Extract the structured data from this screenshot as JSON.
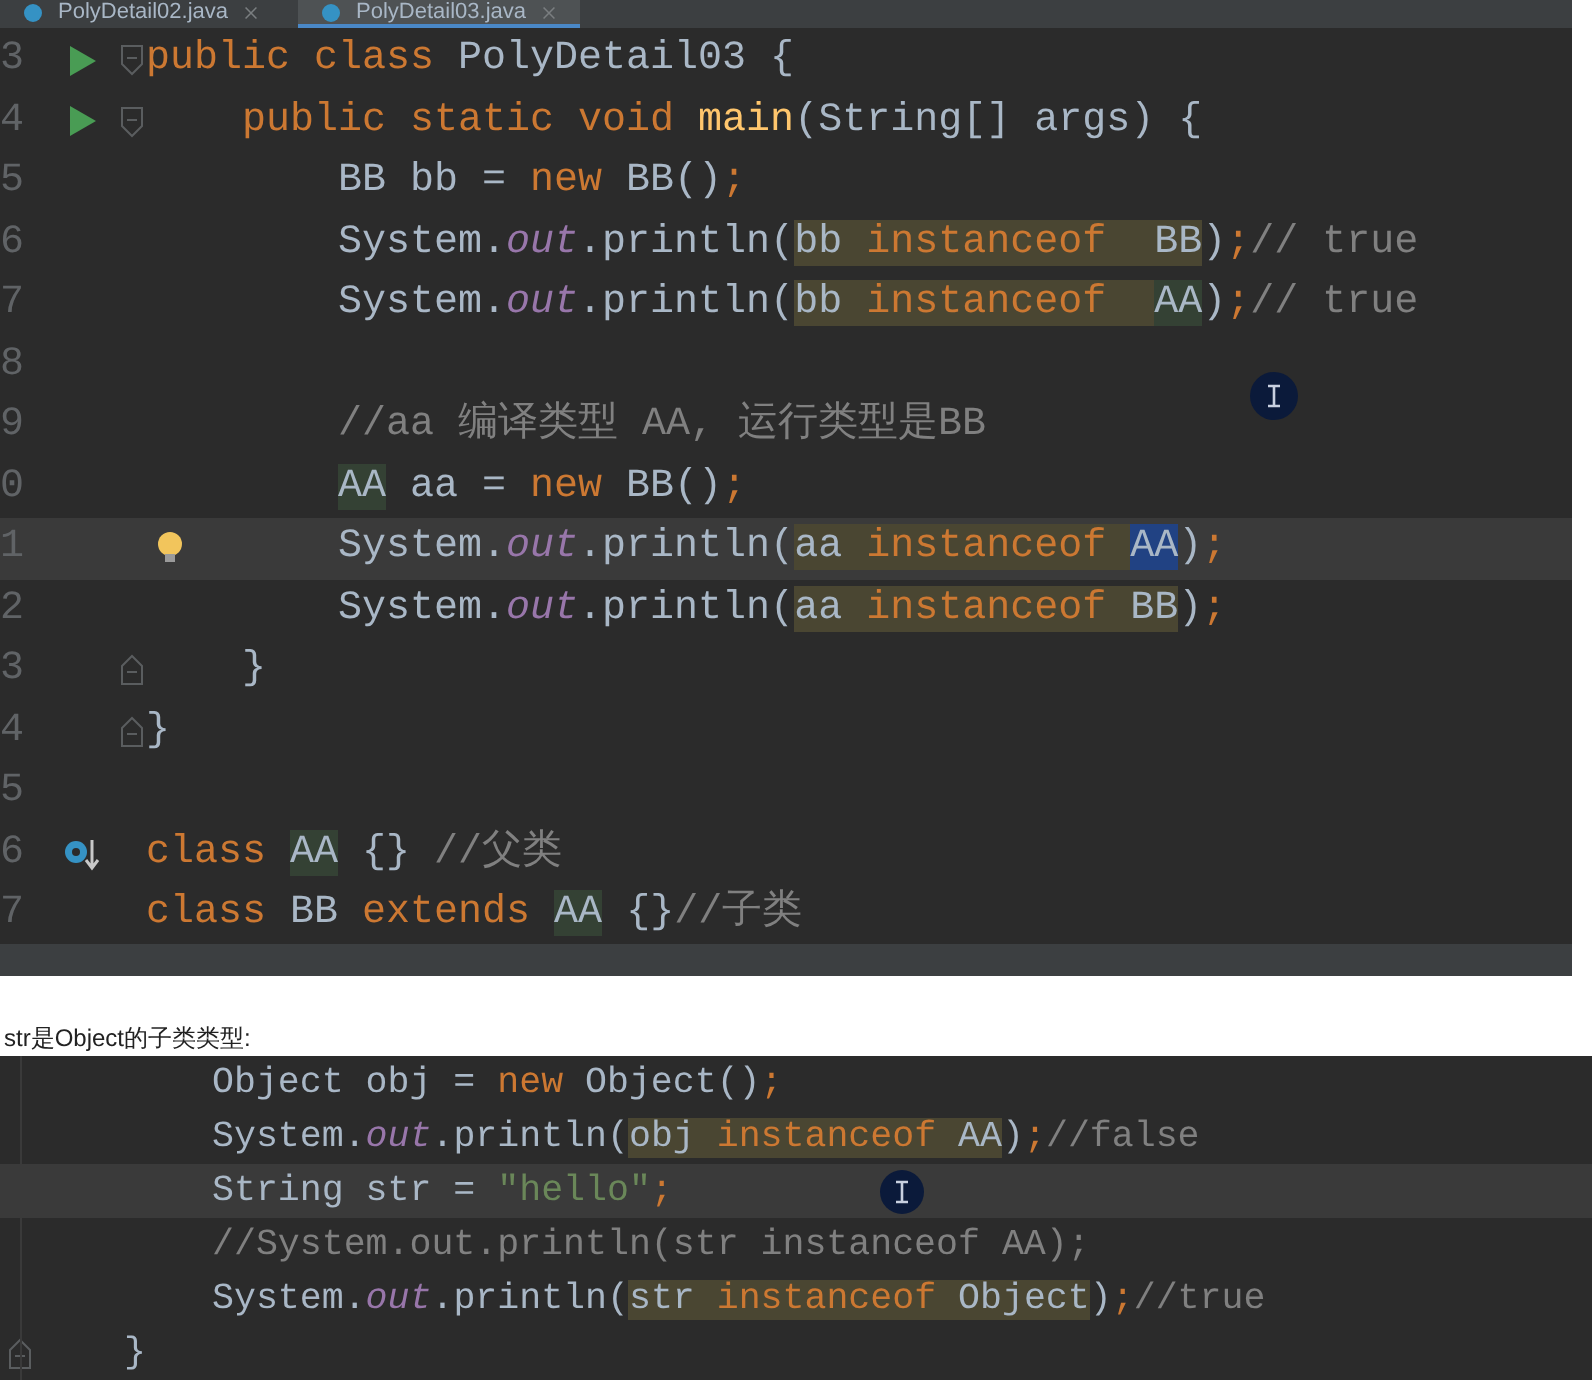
{
  "editor_1": {
    "tabs": [
      {
        "label": "PolyDetail02.java",
        "selected": false
      },
      {
        "label": "PolyDetail03.java",
        "selected": true
      }
    ],
    "lines": [
      {
        "number": "3",
        "kind": "file",
        "current": false,
        "markers": [
          {
            "kind": "run"
          },
          {
            "kind": "fold_open"
          }
        ],
        "tokens": [
          {
            "text": "public class ",
            "kind": "kw"
          },
          {
            "text": "PolyDetail03 {",
            "kind": "plain"
          }
        ]
      },
      {
        "number": "4",
        "kind": "class",
        "current": false,
        "markers": [
          {
            "kind": "run"
          },
          {
            "kind": "fold_open"
          }
        ],
        "tokens": [
          {
            "text": "public static void ",
            "kind": "kw"
          },
          {
            "text": "main",
            "kind": "method"
          },
          {
            "text": "(String[] args) {",
            "kind": "plain"
          }
        ]
      },
      {
        "number": "5",
        "kind": "method",
        "current": false,
        "tokens": [
          {
            "text": "BB bb = ",
            "kind": "plain"
          },
          {
            "text": "new",
            "kind": "kw"
          },
          {
            "text": " BB()",
            "kind": "plain"
          },
          {
            "text": ";",
            "kind": "kw"
          }
        ]
      },
      {
        "number": "6",
        "kind": "method",
        "current": false,
        "tokens": [
          {
            "text": "System.",
            "kind": "plain"
          },
          {
            "text": "out",
            "kind": "field"
          },
          {
            "text": ".println(",
            "kind": "plain"
          },
          {
            "kind": "match",
            "tokens": [
              {
                "text": "bb ",
                "kind": "plain"
              },
              {
                "text": "instanceof  ",
                "kind": "kw"
              },
              {
                "text": "BB",
                "kind": "plain"
              }
            ]
          },
          {
            "text": ")",
            "kind": "plain"
          },
          {
            "text": ";",
            "kind": "kw"
          },
          {
            "text": "// true",
            "kind": "comment"
          }
        ]
      },
      {
        "number": "7",
        "kind": "method",
        "current": false,
        "tokens": [
          {
            "text": "System.",
            "kind": "plain"
          },
          {
            "text": "out",
            "kind": "field"
          },
          {
            "text": ".println(",
            "kind": "plain"
          },
          {
            "kind": "match",
            "tokens": [
              {
                "text": "bb ",
                "kind": "plain"
              },
              {
                "text": "instanceof  ",
                "kind": "kw"
              },
              {
                "text": "AA",
                "kind": "usage"
              }
            ]
          },
          {
            "text": ")",
            "kind": "plain"
          },
          {
            "text": ";",
            "kind": "kw"
          },
          {
            "text": "// true",
            "kind": "comment"
          }
        ]
      },
      {
        "number": "8",
        "kind": "method",
        "current": false
      },
      {
        "number": "9",
        "kind": "method",
        "current": false,
        "tokens": [
          {
            "text": "//aa 编译类型 AA, 运行类型是BB",
            "kind": "comment"
          }
        ]
      },
      {
        "number": "0",
        "kind": "method",
        "current": false,
        "tokens": [
          {
            "text": "AA",
            "kind": "usage"
          },
          {
            "text": " aa = ",
            "kind": "plain"
          },
          {
            "text": "new",
            "kind": "kw"
          },
          {
            "text": " BB()",
            "kind": "plain"
          },
          {
            "text": ";",
            "kind": "kw"
          }
        ]
      },
      {
        "number": "1",
        "kind": "method",
        "current": true,
        "markers": [
          {
            "kind": "bulb"
          }
        ],
        "tokens": [
          {
            "text": "System.",
            "kind": "plain"
          },
          {
            "text": "out",
            "kind": "field"
          },
          {
            "text": ".println(",
            "kind": "plain"
          },
          {
            "kind": "match",
            "tokens": [
              {
                "text": "aa ",
                "kind": "plain"
              },
              {
                "text": "instanceof ",
                "kind": "kw"
              },
              {
                "text": "AA",
                "kind": "selection"
              }
            ]
          },
          {
            "text": ")",
            "kind": "plain"
          },
          {
            "text": ";",
            "kind": "kw"
          }
        ]
      },
      {
        "number": "2",
        "kind": "method",
        "current": false,
        "tokens": [
          {
            "text": "System.",
            "kind": "plain"
          },
          {
            "text": "out",
            "kind": "field"
          },
          {
            "text": ".println(",
            "kind": "plain"
          },
          {
            "kind": "match",
            "tokens": [
              {
                "text": "aa ",
                "kind": "plain"
              },
              {
                "text": "instanceof ",
                "kind": "kw"
              },
              {
                "text": "BB",
                "kind": "plain"
              }
            ]
          },
          {
            "text": ")",
            "kind": "plain"
          },
          {
            "text": ";",
            "kind": "kw"
          }
        ]
      },
      {
        "number": "3",
        "kind": "class",
        "current": false,
        "markers": [
          {
            "kind": "fold_close"
          }
        ],
        "tokens": [
          {
            "text": "}",
            "kind": "plain"
          }
        ]
      },
      {
        "number": "4",
        "kind": "file",
        "current": false,
        "markers": [
          {
            "kind": "fold_close"
          }
        ],
        "tokens": [
          {
            "text": "}",
            "kind": "plain"
          }
        ]
      },
      {
        "number": "5",
        "kind": "file",
        "current": false
      },
      {
        "number": "6",
        "kind": "file",
        "current": false,
        "markers": [
          {
            "kind": "implemented"
          }
        ],
        "tokens": [
          {
            "text": "class ",
            "kind": "kw"
          },
          {
            "text": "AA",
            "kind": "usage"
          },
          {
            "text": " {} ",
            "kind": "plain"
          },
          {
            "text": "//父类",
            "kind": "comment"
          }
        ]
      },
      {
        "number": "7",
        "kind": "file",
        "current": false,
        "tokens": [
          {
            "text": "class ",
            "kind": "kw"
          },
          {
            "text": "BB ",
            "kind": "plain"
          },
          {
            "text": "extends ",
            "kind": "kw"
          },
          {
            "text": "AA",
            "kind": "usage"
          },
          {
            "text": " {}",
            "kind": "plain"
          },
          {
            "text": "//子类",
            "kind": "comment"
          }
        ]
      }
    ]
  },
  "caption": "str是Object的子类类型:",
  "editor_2": {
    "lines": [
      {
        "kind": "method",
        "current": false,
        "tokens": [
          {
            "text": "Object obj = ",
            "kind": "plain"
          },
          {
            "text": "new",
            "kind": "kw"
          },
          {
            "text": " Object()",
            "kind": "plain"
          },
          {
            "text": ";",
            "kind": "kw"
          }
        ]
      },
      {
        "kind": "method",
        "current": false,
        "tokens": [
          {
            "text": "System.",
            "kind": "plain"
          },
          {
            "text": "out",
            "kind": "field"
          },
          {
            "text": ".println(",
            "kind": "plain"
          },
          {
            "kind": "match",
            "tokens": [
              {
                "text": "obj ",
                "kind": "plain"
              },
              {
                "text": "instanceof ",
                "kind": "kw"
              },
              {
                "text": "AA",
                "kind": "plain"
              }
            ]
          },
          {
            "text": ")",
            "kind": "plain"
          },
          {
            "text": ";",
            "kind": "kw"
          },
          {
            "text": "//false",
            "kind": "comment"
          }
        ]
      },
      {
        "kind": "method",
        "current": true,
        "tokens": [
          {
            "text": "String str = ",
            "kind": "plain"
          },
          {
            "text": "\"hello\"",
            "kind": "string"
          },
          {
            "text": ";",
            "kind": "kw"
          }
        ]
      },
      {
        "kind": "method",
        "current": false,
        "tokens": [
          {
            "text": "//System.out.println(str instanceof AA);",
            "kind": "comment"
          }
        ]
      },
      {
        "kind": "method",
        "current": false,
        "tokens": [
          {
            "text": "System.",
            "kind": "plain"
          },
          {
            "text": "out",
            "kind": "field"
          },
          {
            "text": ".println(",
            "kind": "plain"
          },
          {
            "kind": "match",
            "tokens": [
              {
                "text": "str ",
                "kind": "plain"
              },
              {
                "text": "instanceof ",
                "kind": "kw"
              },
              {
                "text": "Object",
                "kind": "plain"
              }
            ]
          },
          {
            "text": ")",
            "kind": "plain"
          },
          {
            "text": ";",
            "kind": "kw"
          },
          {
            "text": "//true",
            "kind": "comment"
          }
        ]
      },
      {
        "kind": "class",
        "current": false,
        "markers": [
          {
            "kind": "fold_close"
          }
        ],
        "tokens": [
          {
            "text": "}",
            "kind": "plain"
          }
        ]
      }
    ]
  }
}
